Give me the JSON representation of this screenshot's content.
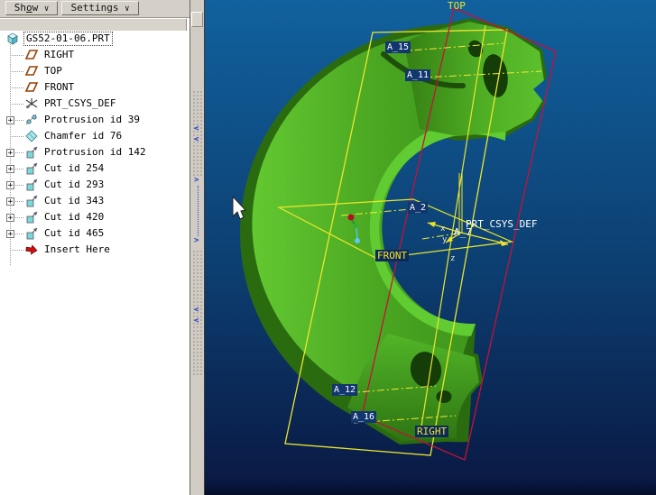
{
  "toolbar": {
    "show_prefix": "Sh",
    "show_mnemonic": "o",
    "show_suffix": "w",
    "settings_label": "Settings",
    "dropdown_arrow": "∨"
  },
  "tree": {
    "root_label": "GS52-01-06.PRT",
    "expand_glyph": "+",
    "items": [
      {
        "label": "RIGHT",
        "icon": "datum-plane"
      },
      {
        "label": "TOP",
        "icon": "datum-plane"
      },
      {
        "label": "FRONT",
        "icon": "datum-plane"
      },
      {
        "label": "PRT_CSYS_DEF",
        "icon": "csys"
      },
      {
        "label": "Protrusion id 39",
        "icon": "revolve",
        "expandable": true
      },
      {
        "label": "Chamfer id 76",
        "icon": "chamfer",
        "expandable": false
      },
      {
        "label": "Protrusion id 142",
        "icon": "extrude",
        "expandable": true
      },
      {
        "label": "Cut id 254",
        "icon": "extrude",
        "expandable": true
      },
      {
        "label": "Cut id 293",
        "icon": "extrude",
        "expandable": true
      },
      {
        "label": "Cut id 343",
        "icon": "extrude",
        "expandable": true
      },
      {
        "label": "Cut id 420",
        "icon": "extrude",
        "expandable": true
      },
      {
        "label": "Cut id 465",
        "icon": "extrude",
        "expandable": true
      },
      {
        "label": "Insert Here",
        "icon": "insert-arrow"
      }
    ]
  },
  "splitter": {
    "collapse_glyph": "<",
    "expand_glyph": ">"
  },
  "viewport": {
    "labels": {
      "top": "TOP",
      "right": "RIGHT",
      "front": "FRONT",
      "csys": "PRT_CSYS_DEF",
      "a15": "A_15",
      "a11": "A_11",
      "a2": "A_2",
      "a7": "A_7",
      "a12": "A_12",
      "a16": "A_16",
      "axis_x": "x",
      "axis_y": "y",
      "axis_z": "z"
    },
    "colors": {
      "background_top": "#11619e",
      "background_bottom": "#0a1a45",
      "part_green_bright": "#5cc02c",
      "part_green_dark": "#2a6b10",
      "datum_yellow": "#ece62c",
      "datum_red": "#c51237",
      "axis_label_bg": "#12366e",
      "axis_label_text": "#ffffff"
    }
  }
}
